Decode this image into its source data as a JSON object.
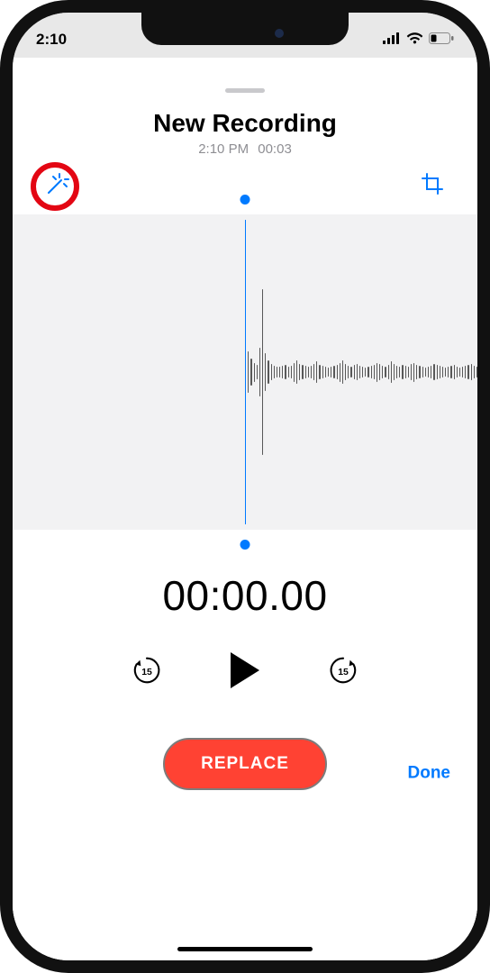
{
  "status": {
    "time": "2:10"
  },
  "title": "New Recording",
  "subtitle_time": "2:10 PM",
  "subtitle_duration": "00:03",
  "timer": "00:00.00",
  "skip_seconds": "15",
  "replace_label": "REPLACE",
  "done_label": "Done",
  "accent_blue": "#007aff",
  "accent_red": "#ff4233",
  "highlight_red": "#e30613",
  "waveform_bar_heights_pct": [
    58,
    22,
    14,
    10,
    8,
    26,
    88,
    20,
    12,
    9,
    7,
    6,
    6,
    7,
    8,
    6,
    7,
    10,
    12,
    9,
    8,
    7,
    6,
    7,
    9,
    11,
    8,
    7,
    6,
    5,
    6,
    7,
    8,
    10,
    12,
    9,
    7,
    6,
    8,
    9,
    7,
    6,
    5,
    6,
    7,
    8,
    10,
    9,
    7,
    6,
    8,
    11,
    9,
    7,
    6,
    8,
    7,
    6,
    9,
    10,
    8,
    7,
    6,
    5,
    6,
    7,
    9,
    8,
    7,
    6,
    5,
    6,
    7,
    8,
    6,
    5,
    6,
    7,
    8,
    9,
    7,
    6
  ]
}
